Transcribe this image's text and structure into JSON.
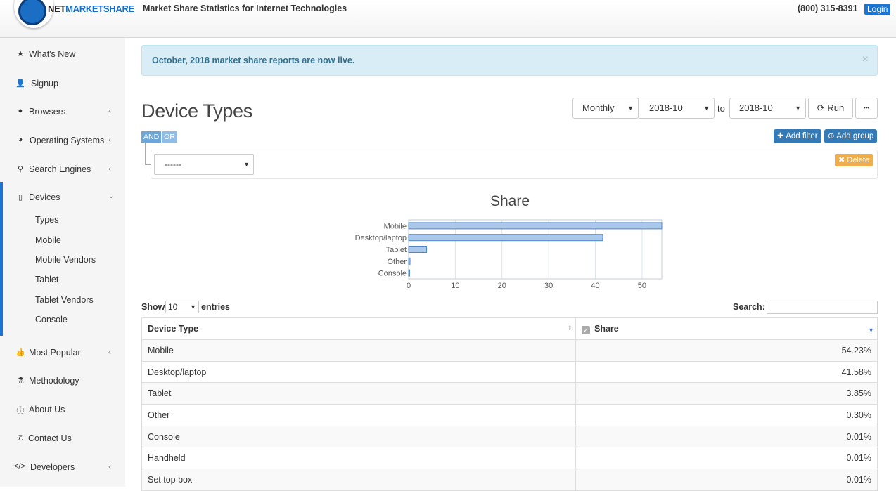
{
  "header": {
    "brand_net": "NET",
    "brand_market": "MARKETSHARE",
    "tagline": "Market Share Statistics for Internet Technologies",
    "phone": "(800) 315-8391",
    "login": "Login"
  },
  "sidebar": {
    "items": [
      {
        "label": "What's New",
        "icon": "star-icon"
      },
      {
        "label": "Signup",
        "icon": "user-plus-icon"
      },
      {
        "label": "Browsers",
        "icon": "globe-icon"
      },
      {
        "label": "Operating Systems",
        "icon": "pie-chart-icon"
      },
      {
        "label": "Search Engines",
        "icon": "search-icon"
      },
      {
        "label": "Devices",
        "icon": "tablet-icon"
      },
      {
        "label": "Most Popular",
        "icon": "thumbs-up-icon"
      },
      {
        "label": "Methodology",
        "icon": "flask-icon"
      },
      {
        "label": "About Us",
        "icon": "info-icon"
      },
      {
        "label": "Contact Us",
        "icon": "phone-icon"
      },
      {
        "label": "Developers",
        "icon": "code-icon"
      }
    ],
    "device_subitems": [
      "Types",
      "Mobile",
      "Mobile Vendors",
      "Tablet",
      "Tablet Vendors",
      "Console"
    ]
  },
  "alert": {
    "text": "October, 2018 market share reports are now live.",
    "close": "×"
  },
  "page": {
    "title": "Device Types"
  },
  "controls": {
    "period": "Monthly",
    "from": "2018-10",
    "to_label": "to",
    "to": "2018-10",
    "run": "Run",
    "more": "•••"
  },
  "filter": {
    "and": "AND",
    "or": "OR",
    "add_filter": "Add filter",
    "add_group": "Add group",
    "rule_value": "------",
    "delete": "Delete"
  },
  "chart_data": {
    "type": "bar",
    "orientation": "horizontal",
    "title": "Share",
    "categories": [
      "Mobile",
      "Desktop/laptop",
      "Tablet",
      "Other",
      "Console"
    ],
    "values": [
      54.23,
      41.58,
      3.85,
      0.3,
      0.01
    ],
    "xticks": [
      0,
      10,
      20,
      30,
      40,
      50
    ],
    "xlim": [
      0,
      54.23
    ],
    "grid": true,
    "colors": {
      "fill": "#a9c8ec",
      "stroke": "#4f86c6"
    }
  },
  "table_controls": {
    "show": "Show",
    "page_size": "10",
    "entries": "entries",
    "search": "Search:"
  },
  "table": {
    "headers": [
      "Device Type",
      "Share"
    ],
    "rows": [
      [
        "Mobile",
        "54.23%"
      ],
      [
        "Desktop/laptop",
        "41.58%"
      ],
      [
        "Tablet",
        "3.85%"
      ],
      [
        "Other",
        "0.30%"
      ],
      [
        "Console",
        "0.01%"
      ],
      [
        "Handheld",
        "0.01%"
      ],
      [
        "Set top box",
        "0.01%"
      ]
    ]
  }
}
